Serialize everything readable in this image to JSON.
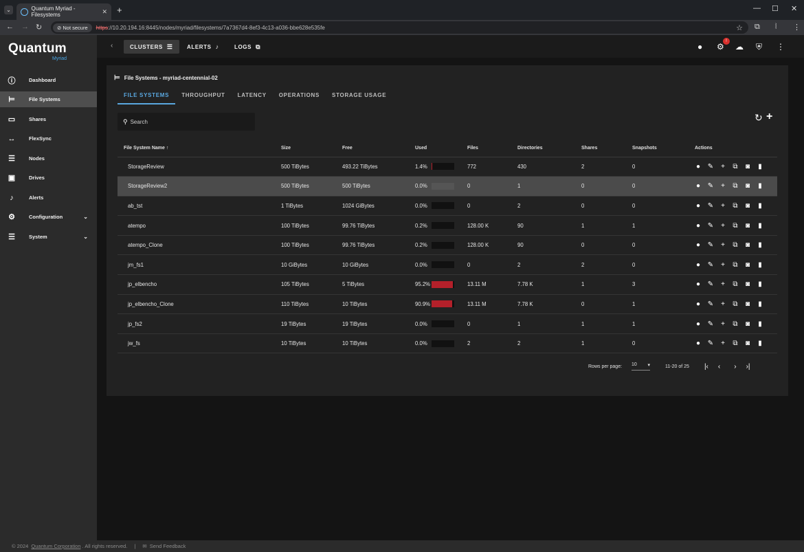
{
  "browser": {
    "tab_title": "Quantum Myriad - Filesystems",
    "not_secure": "Not secure",
    "url_scheme": "https",
    "url_rest": "://10.20.194.16:8445/nodes/myriad/filesystems/7a7367d4-8ef3-4c13-a036-bbe628e535fe"
  },
  "brand": {
    "name": "Quantum",
    "product": "Myriad"
  },
  "sidebar": {
    "items": [
      {
        "label": "Dashboard"
      },
      {
        "label": "File Systems"
      },
      {
        "label": "Shares"
      },
      {
        "label": "FlexSync"
      },
      {
        "label": "Nodes"
      },
      {
        "label": "Drives"
      },
      {
        "label": "Alerts"
      },
      {
        "label": "Configuration"
      },
      {
        "label": "System"
      }
    ]
  },
  "topbar": {
    "clusters": "CLUSTERS",
    "alerts": "ALERTS",
    "logs": "LOGS",
    "badge": "!"
  },
  "panel": {
    "title": "File Systems - myriad-centennial-02",
    "tabs": [
      "FILE SYSTEMS",
      "THROUGHPUT",
      "LATENCY",
      "OPERATIONS",
      "STORAGE USAGE"
    ],
    "search_placeholder": "Search"
  },
  "table": {
    "headers": [
      "File System Name",
      "Size",
      "Free",
      "Used",
      "Files",
      "Directories",
      "Shares",
      "Snapshots",
      "Actions"
    ],
    "rows": [
      {
        "name": "StorageReview",
        "size": "500 TiBytes",
        "free": "493.22 TiBytes",
        "used": "1.4%",
        "used_frac": 0.014,
        "files": "772",
        "dirs": "430",
        "shares": "2",
        "snaps": "0"
      },
      {
        "name": "StorageReview2",
        "size": "500 TiBytes",
        "free": "500 TiBytes",
        "used": "0.0%",
        "used_frac": 0.0,
        "files": "0",
        "dirs": "1",
        "shares": "0",
        "snaps": "0"
      },
      {
        "name": "ab_tst",
        "size": "1 TiBytes",
        "free": "1024 GiBytes",
        "used": "0.0%",
        "used_frac": 0.0,
        "files": "0",
        "dirs": "2",
        "shares": "0",
        "snaps": "0"
      },
      {
        "name": "atempo",
        "size": "100 TiBytes",
        "free": "99.76 TiBytes",
        "used": "0.2%",
        "used_frac": 0.002,
        "files": "128.00 K",
        "dirs": "90",
        "shares": "1",
        "snaps": "1"
      },
      {
        "name": "atempo_Clone",
        "size": "100 TiBytes",
        "free": "99.76 TiBytes",
        "used": "0.2%",
        "used_frac": 0.002,
        "files": "128.00 K",
        "dirs": "90",
        "shares": "0",
        "snaps": "0"
      },
      {
        "name": "jm_fs1",
        "size": "10 GiBytes",
        "free": "10 GiBytes",
        "used": "0.0%",
        "used_frac": 0.0,
        "files": "0",
        "dirs": "2",
        "shares": "2",
        "snaps": "0"
      },
      {
        "name": "jp_elbencho",
        "size": "105 TiBytes",
        "free": "5 TiBytes",
        "used": "95.2%",
        "used_frac": 0.952,
        "files": "13.11 M",
        "dirs": "7.78 K",
        "shares": "1",
        "snaps": "3"
      },
      {
        "name": "jp_elbencho_Clone",
        "size": "110 TiBytes",
        "free": "10 TiBytes",
        "used": "90.9%",
        "used_frac": 0.909,
        "files": "13.11 M",
        "dirs": "7.78 K",
        "shares": "0",
        "snaps": "1"
      },
      {
        "name": "jp_fs2",
        "size": "19 TiBytes",
        "free": "19 TiBytes",
        "used": "0.0%",
        "used_frac": 0.0,
        "files": "0",
        "dirs": "1",
        "shares": "1",
        "snaps": "1"
      },
      {
        "name": "jw_fs",
        "size": "10 TiBytes",
        "free": "10 TiBytes",
        "used": "0.0%",
        "used_frac": 0.0,
        "files": "2",
        "dirs": "2",
        "shares": "1",
        "snaps": "0"
      }
    ]
  },
  "pager": {
    "rows_per_page_label": "Rows per page:",
    "rows_per_page": "10",
    "range": "11-20 of 25"
  },
  "footer": {
    "copyright": "© 2024",
    "company": "Quantum Corporation",
    "rights": ". All rights reserved.",
    "feedback": "Send Feedback"
  },
  "colors": {
    "accent": "#5aa8e0",
    "danger": "#b3202a",
    "selected_row": "#4b4b4b"
  }
}
